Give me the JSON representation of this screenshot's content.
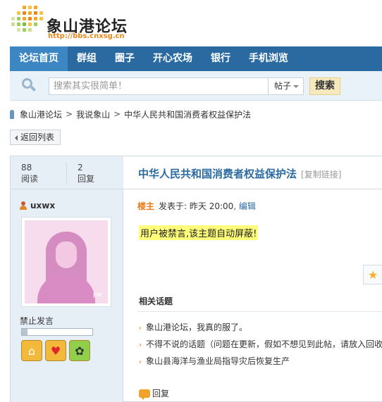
{
  "logo": {
    "name": "象山港论坛",
    "url": "http://bbs.cnxsg.cn"
  },
  "nav": {
    "items": [
      {
        "label": "论坛首页",
        "active": true
      },
      {
        "label": "群组"
      },
      {
        "label": "圈子"
      },
      {
        "label": "开心农场"
      },
      {
        "label": "银行"
      },
      {
        "label": "手机浏览"
      }
    ]
  },
  "search": {
    "placeholder": "搜索其实很简单！",
    "type": "帖子",
    "button": "搜索"
  },
  "breadcrumb": {
    "items": [
      "象山港论坛",
      "我说象山",
      "中华人民共和国消费者权益保护法"
    ],
    "separator": ">"
  },
  "back_button": "返回列表",
  "stats": {
    "views": "88",
    "views_label": "阅读",
    "replies": "2",
    "replies_label": "回复"
  },
  "thread": {
    "title": "中华人民共和国消费者权益保护法",
    "copy_link": "[复制链接]"
  },
  "author": {
    "name": "uxwx",
    "avatar_watermark": "pw",
    "status": "禁止发言",
    "level_progress": 0.08,
    "badges": [
      "home-icon",
      "heart-icon",
      "bee-icon"
    ]
  },
  "post": {
    "floor": "楼主",
    "posted_label": "发表于: 昨天 20:00",
    "edit": "编辑",
    "banned_notice": "用户被禁言,该主题自动屏蔽!"
  },
  "related": {
    "title": "相关话题",
    "items": [
      "象山港论坛，我真的服了。",
      "不得不说的话题（问题在更新，假如不想见到此帖，请放入回收",
      "象山县海洋与渔业局指导灾后恢复生产"
    ]
  },
  "reply_label": "回复",
  "colors": {
    "nav": "#2a6aa0",
    "nav_active": "#3c86c4",
    "accent": "#e87a17",
    "highlight": "#ffff7a"
  }
}
